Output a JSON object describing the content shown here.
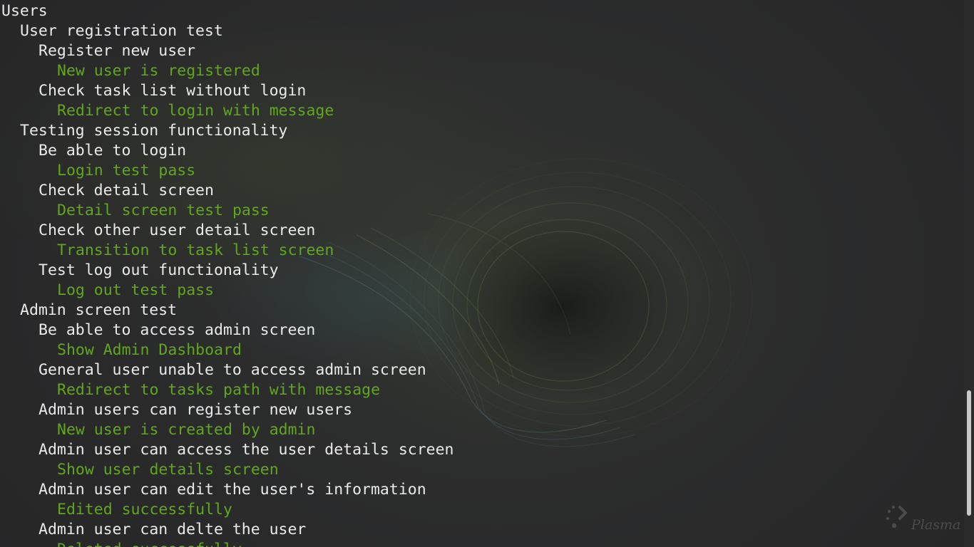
{
  "terminal": {
    "lines": [
      {
        "text": "Users",
        "kind": "suite",
        "indent": 0
      },
      {
        "text": "User registration test",
        "kind": "suite",
        "indent": 1
      },
      {
        "text": "Register new user",
        "kind": "test",
        "indent": 2
      },
      {
        "text": "New user is registered",
        "kind": "pass",
        "indent": 3
      },
      {
        "text": "Check task list without login",
        "kind": "test",
        "indent": 2
      },
      {
        "text": "Redirect to login with message",
        "kind": "pass",
        "indent": 3
      },
      {
        "text": "Testing session functionality",
        "kind": "suite",
        "indent": 1
      },
      {
        "text": "Be able to login",
        "kind": "test",
        "indent": 2
      },
      {
        "text": "Login test pass",
        "kind": "pass",
        "indent": 3
      },
      {
        "text": "Check detail screen",
        "kind": "test",
        "indent": 2
      },
      {
        "text": "Detail screen test pass",
        "kind": "pass",
        "indent": 3
      },
      {
        "text": "Check other user detail screen",
        "kind": "test",
        "indent": 2
      },
      {
        "text": "Transition to task list screen",
        "kind": "pass",
        "indent": 3
      },
      {
        "text": "Test log out functionality",
        "kind": "test",
        "indent": 2
      },
      {
        "text": "Log out test pass",
        "kind": "pass",
        "indent": 3
      },
      {
        "text": "Admin screen test",
        "kind": "suite",
        "indent": 1
      },
      {
        "text": "Be able to access admin screen",
        "kind": "test",
        "indent": 2
      },
      {
        "text": "Show Admin Dashboard",
        "kind": "pass",
        "indent": 3
      },
      {
        "text": "General user unable to access admin screen",
        "kind": "test",
        "indent": 2
      },
      {
        "text": "Redirect to tasks path with message",
        "kind": "pass",
        "indent": 3
      },
      {
        "text": "Admin users can register new users",
        "kind": "test",
        "indent": 2
      },
      {
        "text": "New user is created by admin",
        "kind": "pass",
        "indent": 3
      },
      {
        "text": "Admin user can access the user details screen",
        "kind": "test",
        "indent": 2
      },
      {
        "text": "Show user details screen",
        "kind": "pass",
        "indent": 3
      },
      {
        "text": "Admin user can edit the user's information",
        "kind": "test",
        "indent": 2
      },
      {
        "text": "Edited successfully",
        "kind": "pass",
        "indent": 3
      },
      {
        "text": "Admin user can delte the user",
        "kind": "test",
        "indent": 2
      },
      {
        "text": "Deleted successfully",
        "kind": "pass",
        "indent": 3
      }
    ],
    "colors": {
      "background": "#2a2b2c",
      "text": "#eaeaea",
      "pass": "#5fa81a"
    },
    "scroll_position": 0.93
  },
  "wallpaper": {
    "logo_text": "Plasma",
    "logo_icon": "plasma-icon"
  }
}
